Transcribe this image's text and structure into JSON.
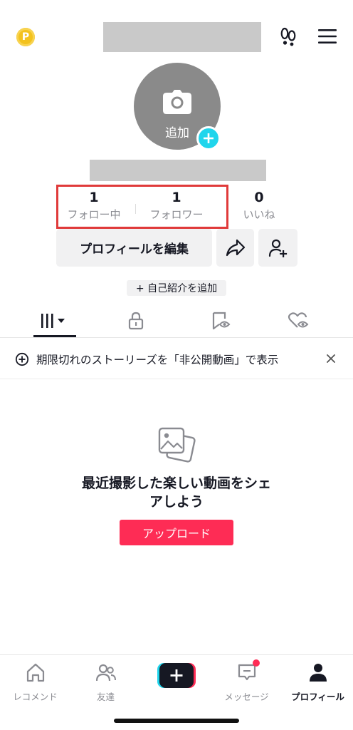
{
  "header": {
    "coin_symbol": "P",
    "username_redacted": "",
    "footprint_icon": "footprints-icon",
    "menu_icon": "hamburger-menu-icon"
  },
  "avatar": {
    "add_label": "追加",
    "camera_icon": "camera-icon",
    "badge_icon": "plus-icon"
  },
  "stats": {
    "following_count": "1",
    "following_label": "フォロー中",
    "followers_count": "1",
    "followers_label": "フォロワー",
    "likes_count": "0",
    "likes_label": "いいね"
  },
  "actions": {
    "edit_profile_label": "プロフィールを編集",
    "share_icon": "share-arrow-icon",
    "add_friend_icon": "add-user-icon",
    "add_bio_label": "+ 自己紹介を追加"
  },
  "tabs": [
    {
      "icon": "grid-dropdown-icon",
      "active": true
    },
    {
      "icon": "lock-icon",
      "active": false
    },
    {
      "icon": "bookmark-eye-icon",
      "active": false
    },
    {
      "icon": "heart-eye-icon",
      "active": false
    }
  ],
  "notice": {
    "text": "期限切れのストーリーズを「非公開動画」で表示",
    "icon": "plus-circle-icon",
    "close_icon": "close-icon"
  },
  "empty_state": {
    "icon": "photos-icon",
    "title_line1": "最近撮影した楽しい動画をシェ",
    "title_line2": "アしよう",
    "upload_label": "アップロード"
  },
  "bottom_nav": {
    "home_label": "レコメンド",
    "friends_label": "友達",
    "create_icon": "create-plus-icon",
    "inbox_label": "メッセージ",
    "profile_label": "プロフィール"
  },
  "colors": {
    "accent": "#fe2c55",
    "cyan": "#20d5ec",
    "highlight": "#e03a3a",
    "coin": "#f3c21d"
  }
}
